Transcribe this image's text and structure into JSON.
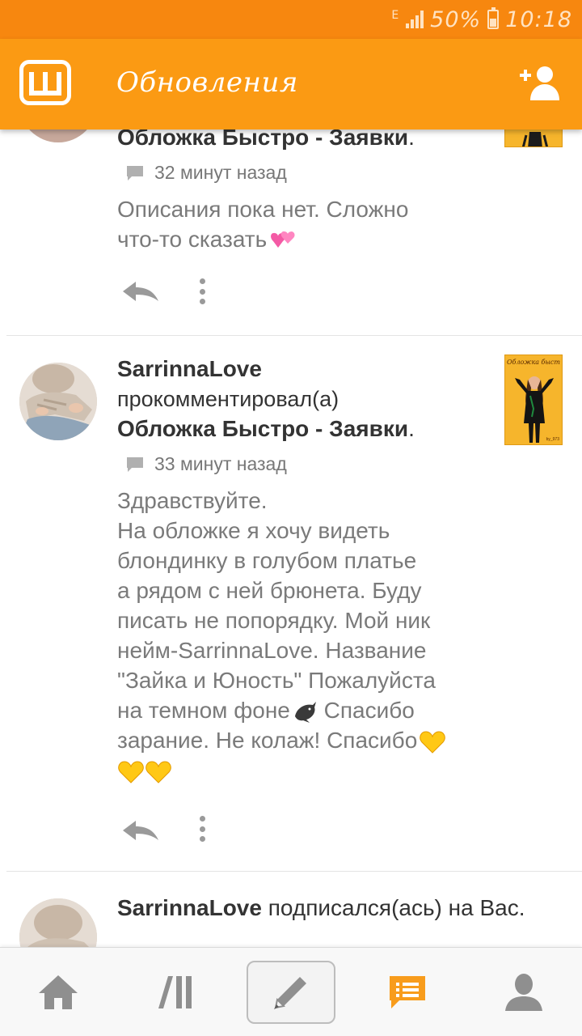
{
  "status_bar": {
    "network_label": "E",
    "battery": "50%",
    "battery_level": 0.5,
    "time": "10:18"
  },
  "app_bar": {
    "logo_icon": "wattpad-logo-icon",
    "title": "Обновления",
    "add_user_icon": "add-friend-icon"
  },
  "feed": {
    "items": [
      {
        "story": "Обложка Быстро - Заявки",
        "story_suffix": ".",
        "time": "32 минут назад",
        "message_lines": [
          "Описания пока нет. Сложно",
          "что-то сказать"
        ],
        "trailing_emoji": "two-hearts"
      },
      {
        "author": "SarrinnaLove",
        "action": "прокомментировал(а)",
        "story": "Обложка Быстро - Заявки",
        "story_suffix": ".",
        "time": "33 минут назад",
        "message_lines": [
          "Здравствуйте.",
          "На обложке я хочу видеть",
          "блондинку в голубом платье",
          "а рядом с ней брюнета. Буду",
          "писать не попорядку. Мой ник",
          "нейм-SarrinnaLove. Название",
          "\"Зайка и Юность\" Пожалуйста",
          "на темном фоне",
          "Спасибо",
          "зарание. Не колаж! Спасибо"
        ],
        "thumbnail": {
          "title": "Обложка быстро",
          "credit": "by_973"
        }
      },
      {
        "author": "SarrinnaLove",
        "action": "подписался(ась) на Вас."
      }
    ]
  },
  "bottom_nav": {
    "items": [
      {
        "icon": "home-icon",
        "name": "nav-home"
      },
      {
        "icon": "library-icon",
        "name": "nav-library"
      },
      {
        "icon": "pencil-icon",
        "name": "nav-write"
      },
      {
        "icon": "notifications-icon",
        "name": "nav-updates"
      },
      {
        "icon": "profile-icon",
        "name": "nav-profile"
      }
    ]
  },
  "colors": {
    "status_bar": "#f7870f",
    "app_bar": "#fb9a13",
    "accent": "#f89c1c",
    "icon_grey": "#8f8f8f"
  }
}
